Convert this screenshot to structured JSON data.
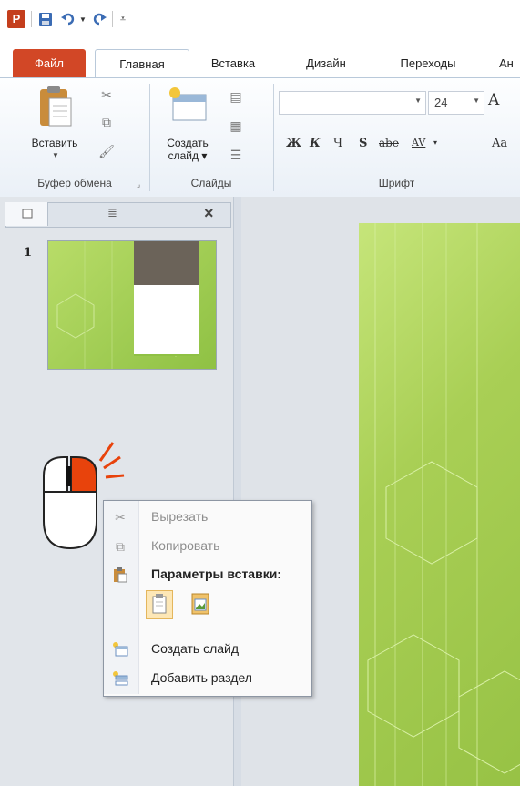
{
  "quick_access": {
    "app_letter": "P",
    "items": [
      "save",
      "undo",
      "undo-dropdown",
      "redo",
      "customize"
    ]
  },
  "tabs": [
    {
      "label": "Файл"
    },
    {
      "label": "Главная"
    },
    {
      "label": "Вставка"
    },
    {
      "label": "Дизайн"
    },
    {
      "label": "Переходы"
    },
    {
      "label": "Ан"
    }
  ],
  "ribbon": {
    "clipboard": {
      "paste_label": "Вставить",
      "group_label": "Буфер обмена"
    },
    "slides": {
      "new_slide_line1": "Создать",
      "new_slide_line2": "слайд",
      "group_label": "Слайды"
    },
    "font": {
      "size_value": "24",
      "group_label": "Шрифт",
      "buttons": [
        "Ж",
        "К",
        "Ч",
        "S",
        "abe",
        "AV",
        "Aa"
      ],
      "grow_glyph": "A"
    }
  },
  "slides_pane": {
    "slide_number": "1",
    "close_glyph": "×"
  },
  "context_menu": {
    "items": [
      {
        "label": "Вырезать",
        "disabled": true
      },
      {
        "label": "Копировать",
        "disabled": true
      },
      {
        "label": "Параметры вставки:",
        "header": true
      },
      {
        "label": "Создать слайд"
      },
      {
        "label": "Добавить раздел"
      }
    ]
  },
  "colors": {
    "file_tab": "#d24726",
    "slide_green": "#a9cf55",
    "mouse_highlight": "#e8430c"
  }
}
